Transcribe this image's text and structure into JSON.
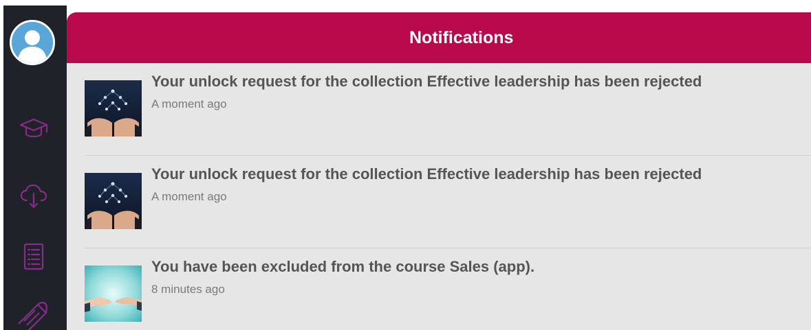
{
  "header": {
    "title": "Notifications"
  },
  "sidebar": {
    "items": [
      {
        "name": "avatar",
        "icon": "user-avatar-icon"
      },
      {
        "name": "courses",
        "icon": "graduation-cap-icon"
      },
      {
        "name": "downloads",
        "icon": "cloud-download-icon"
      },
      {
        "name": "catalog",
        "icon": "list-icon"
      },
      {
        "name": "certificates",
        "icon": "diploma-scroll-icon"
      }
    ],
    "accent_color": "#8a2a8c"
  },
  "notifications": [
    {
      "title": "Your unlock request for the collection Effective leadership has been rejected",
      "time": "A moment ago",
      "thumbnail": "leadership-hands-image"
    },
    {
      "title": "Your unlock request for the collection Effective leadership has been rejected",
      "time": "A moment ago",
      "thumbnail": "leadership-hands-image"
    },
    {
      "title": "You have been excluded from the course Sales (app).",
      "time": "8 minutes ago",
      "thumbnail": "handshake-image"
    }
  ],
  "colors": {
    "header_bg": "#b80a4b",
    "sidebar_bg": "#1f2329",
    "panel_bg": "#e6e6e6",
    "title_text": "#555555",
    "time_text": "#7a7a7a"
  }
}
